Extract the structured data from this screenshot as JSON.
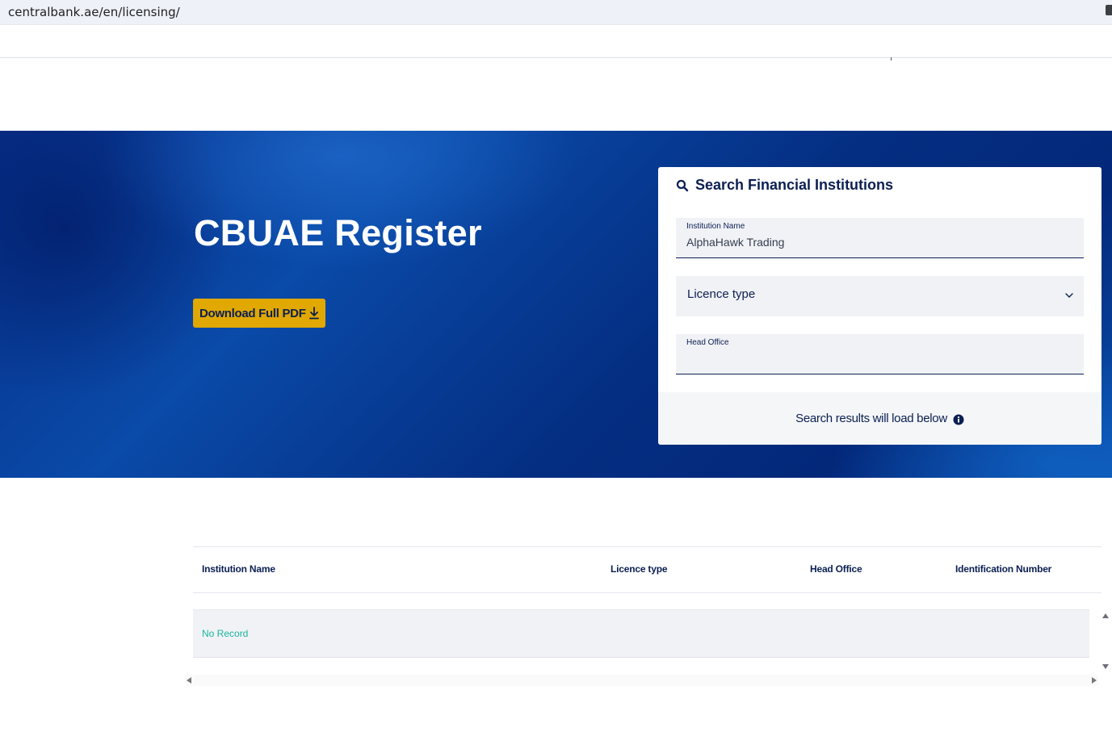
{
  "browser": {
    "url": "centralbank.ae/en/licensing/"
  },
  "hero": {
    "title": "CBUAE Register",
    "download_label": "Download Full PDF",
    "accent_color": "#e0a800"
  },
  "search": {
    "title": "Search Financial Institutions",
    "institution_name": {
      "label": "Institution Name",
      "value": "AlphaHawk Trading"
    },
    "licence_type": {
      "selected": "Licence type"
    },
    "head_office": {
      "label": "Head Office",
      "value": ""
    },
    "note": "Search results will load below"
  },
  "table": {
    "columns": [
      "Institution Name",
      "Licence type",
      "Head Office",
      "Identification Number"
    ],
    "empty_text": "No Record"
  },
  "colors": {
    "navy": "#0b1f52",
    "empty_text": "#1ab4a0"
  }
}
